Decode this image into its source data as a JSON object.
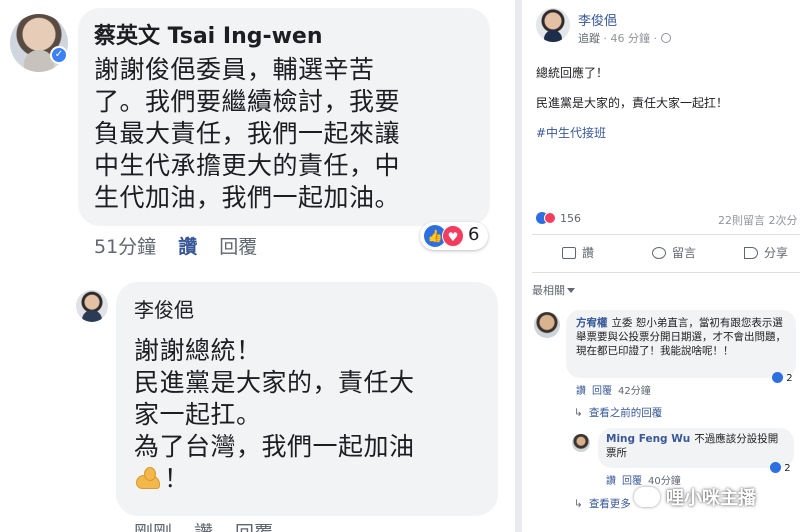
{
  "left": {
    "comment1": {
      "author": "蔡英文 Tsai Ing-wen",
      "lines": [
        "謝謝俊俋委員，輔選辛苦",
        "了。我們要繼續檢討，我要",
        "負最大責任，我們一起來讓",
        "中生代承擔更大的責任，中",
        "生代加油，我們一起加油。"
      ],
      "time": "51分鐘",
      "like_label": "讚",
      "reply_label": "回覆",
      "reaction_count": "6"
    },
    "comment2": {
      "author": "李俊俋",
      "lines": [
        "謝謝總統！",
        "民進黨是大家的，責任大",
        "家一起扛。",
        "為了台灣，我們一起加油"
      ],
      "last_line_suffix": "！",
      "emoji": "flexed-biceps-icon",
      "time": "剛剛",
      "like_label": "讚",
      "reply_label": "回覆"
    }
  },
  "right": {
    "post": {
      "author": "李俊俋",
      "follow_label": "追蹤",
      "time": "46 分鐘",
      "line1": "總統回應了！",
      "line2": "民進黨是大家的，責任大家一起扛！",
      "hashtag": "#中生代接班"
    },
    "stats": {
      "reactions": "156",
      "comments_shares": "22則留言  2次分"
    },
    "actions": {
      "like": "讚",
      "comment": "留言",
      "share": "分享"
    },
    "sort_label": "最相關",
    "comments": [
      {
        "author": "方宥權",
        "text": "立委 恕小弟直言，當初有跟您表示選舉票要與公投票分開日期選，才不會出問題，現在都已印證了！我能說啥呢！！",
        "like_label": "讚",
        "reply_label": "回覆",
        "time": "42分鐘",
        "reactions": "2",
        "more_label": "查看之前的回覆"
      },
      {
        "author": "Ming Feng Wu",
        "text": "不過應該分設投開票所",
        "like_label": "讚",
        "reply_label": "回覆",
        "time": "40分鐘",
        "reactions": "2",
        "more_label": "查看更多"
      }
    ]
  },
  "watermark": "哩小咪主播",
  "colors": {
    "link_blue": "#385898",
    "bubble_gray": "#f2f3f5",
    "like_blue": "#2d6fe0",
    "love_red": "#f23d5e"
  }
}
